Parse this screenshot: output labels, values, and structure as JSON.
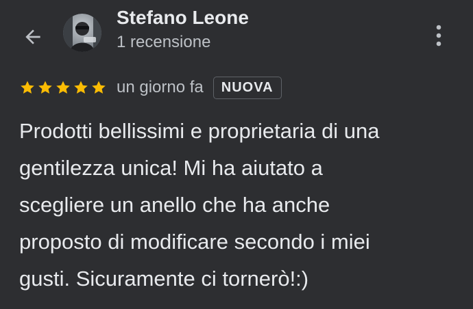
{
  "header": {
    "back_icon": "arrow-back-icon",
    "reviewer_name": "Stefano Leone",
    "review_count": "1 recensione",
    "more_icon": "more-vert-icon"
  },
  "review": {
    "rating": 5,
    "rating_max": 5,
    "star_color": "#fbbc04",
    "date": "un giorno fa",
    "badge": "NUOVA",
    "lines": [
      "Prodotti bellissimi e proprietaria di una",
      "gentilezza unica! Mi ha aiutato a",
      "scegliere un anello che ha anche",
      "proposto di modificare secondo i miei",
      "gusti. Sicuramente ci tornerò!:)"
    ]
  },
  "colors": {
    "background": "#2d2e31",
    "text_primary": "#e8eaed",
    "text_secondary": "#bdc1c6"
  }
}
